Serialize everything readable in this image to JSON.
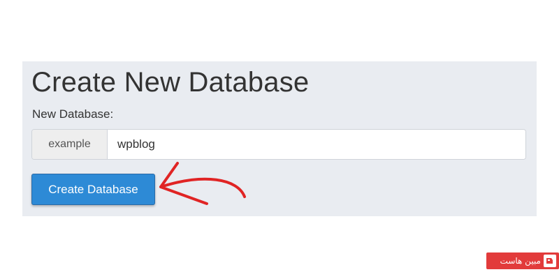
{
  "form": {
    "title": "Create New Database",
    "field_label": "New Database:",
    "prefix": "example",
    "db_name_value": "wpblog",
    "submit_label": "Create Database"
  },
  "watermark": {
    "text": "مبین هاست"
  },
  "colors": {
    "panel_bg": "#e9ecf1",
    "button_bg": "#2d8ad6",
    "arrow": "#e02424",
    "watermark_bg": "#e23b3b"
  }
}
